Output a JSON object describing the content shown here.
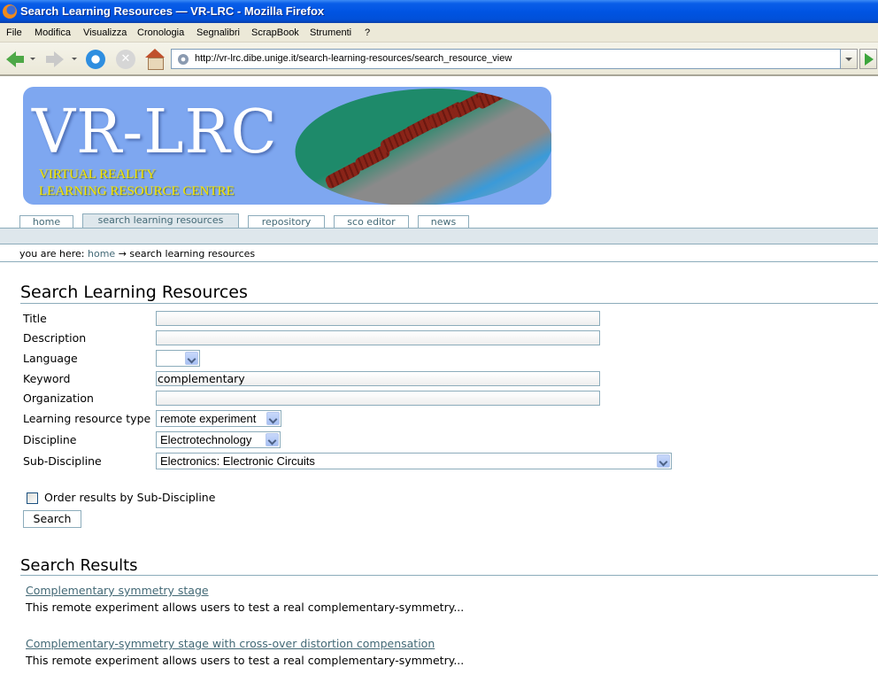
{
  "window": {
    "title": "Search Learning Resources — VR-LRC - Mozilla Firefox"
  },
  "menu": [
    "File",
    "Modifica",
    "Visualizza",
    "Cronologia",
    "Segnalibri",
    "ScrapBook",
    "Strumenti",
    "?"
  ],
  "navigation": {
    "url": "http://vr-lrc.dibe.unige.it/search-learning-resources/search_resource_view"
  },
  "banner": {
    "logo": "VR-LRC",
    "subtitle_line1": "VIRTUAL REALITY",
    "subtitle_line2": "LEARNING RESOURCE CENTRE"
  },
  "tabs": [
    {
      "label": "home",
      "active": false
    },
    {
      "label": "search learning resources",
      "active": true
    },
    {
      "label": "repository",
      "active": false
    },
    {
      "label": "sco editor",
      "active": false
    },
    {
      "label": "news",
      "active": false
    }
  ],
  "breadcrumb": {
    "prefix": "you are here:",
    "home": "home",
    "separator": "→",
    "current": "search learning resources"
  },
  "form": {
    "heading": "Search Learning Resources",
    "fields": {
      "title": {
        "label": "Title",
        "value": ""
      },
      "description": {
        "label": "Description",
        "value": ""
      },
      "language": {
        "label": "Language",
        "value": ""
      },
      "keyword": {
        "label": "Keyword",
        "value": "complementary"
      },
      "organization": {
        "label": "Organization",
        "value": ""
      },
      "resource_type": {
        "label": "Learning resource type",
        "value": "remote experiment"
      },
      "discipline": {
        "label": "Discipline",
        "value": "Electrotechnology"
      },
      "sub_discipline": {
        "label": "Sub-Discipline",
        "value": "Electronics: Electronic Circuits"
      }
    },
    "order_checkbox": {
      "label": "Order results by Sub-Discipline",
      "checked": false
    },
    "search_button": "Search"
  },
  "results": {
    "heading": "Search Results",
    "items": [
      {
        "title": "Complementary symmetry stage",
        "description": "This remote experiment allows users to test a real complementary-symmetry..."
      },
      {
        "title": "Complementary-symmetry stage with cross-over distortion compensation",
        "description": "This remote experiment allows users to test a real complementary-symmetry..."
      }
    ]
  }
}
